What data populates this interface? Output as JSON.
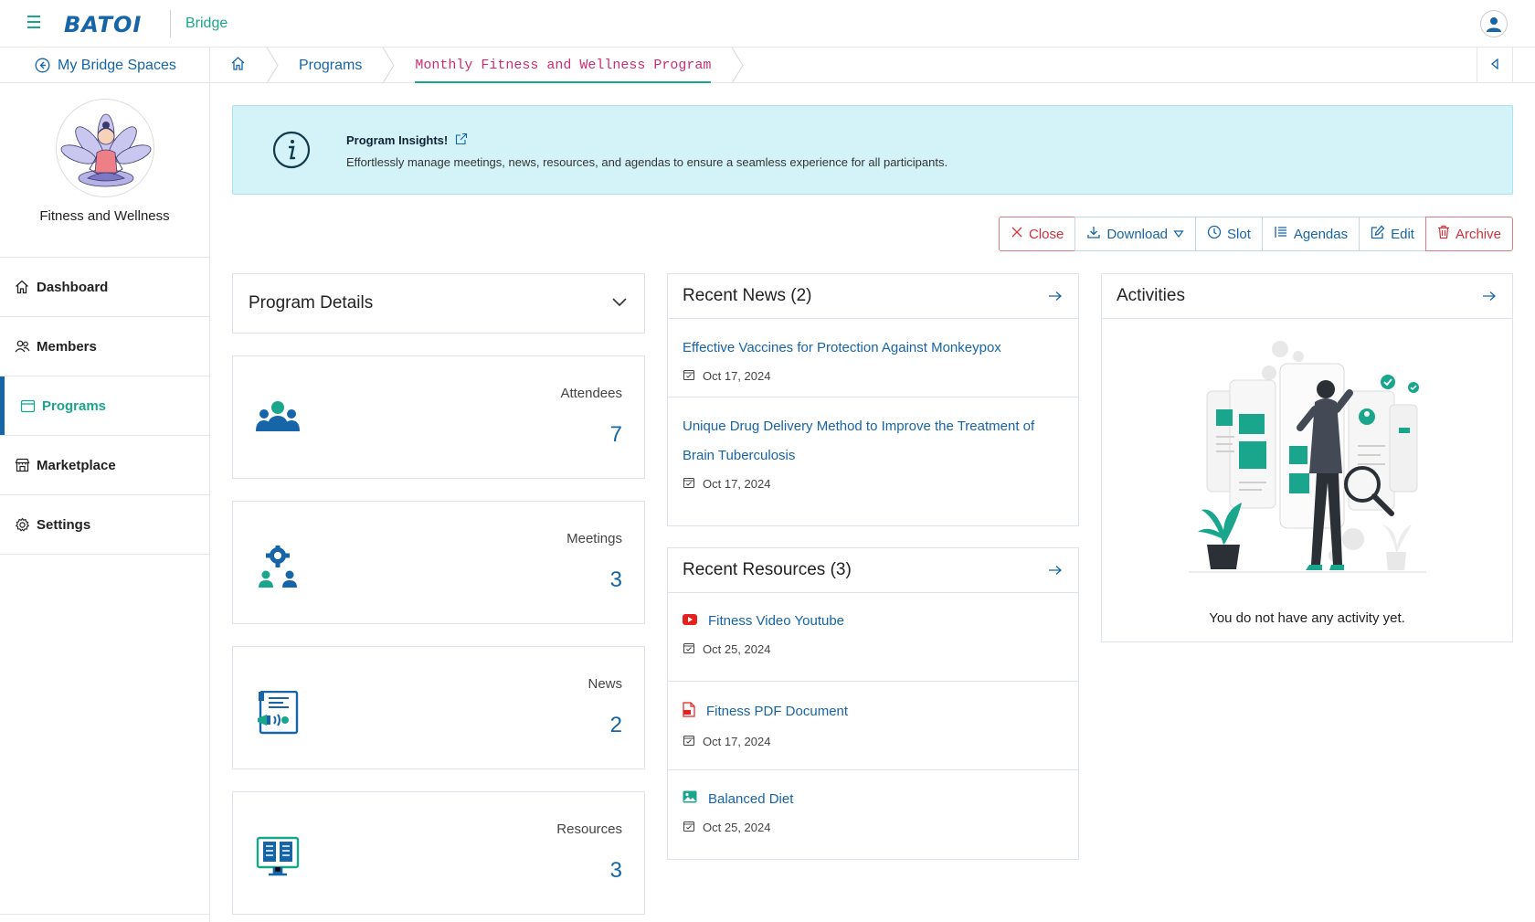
{
  "app": {
    "logo_text": "BATOI",
    "name": "Bridge",
    "brand_color": "#1565a8",
    "accent_color": "#1aa68c",
    "active_crumb_color": "#d02c72"
  },
  "subnav": {
    "back_label": "My Bridge Spaces",
    "breadcrumbs": [
      "Programs",
      "Monthly Fitness and Wellness Program"
    ]
  },
  "sidebar": {
    "space_name": "Fitness and Wellness",
    "items": [
      {
        "label": "Dashboard",
        "icon": "home-icon"
      },
      {
        "label": "Members",
        "icon": "members-icon"
      },
      {
        "label": "Programs",
        "icon": "calendar-icon",
        "active": true
      },
      {
        "label": "Marketplace",
        "icon": "store-icon"
      },
      {
        "label": "Settings",
        "icon": "gear-icon"
      }
    ]
  },
  "insight": {
    "title": "Program Insights!",
    "text": "Effortlessly manage meetings, news, resources, and agendas to ensure a seamless experience for all participants."
  },
  "actions": {
    "close": "Close",
    "download": "Download",
    "slot": "Slot",
    "agendas": "Agendas",
    "edit": "Edit",
    "archive": "Archive"
  },
  "program_details": {
    "title": "Program Details"
  },
  "stats": [
    {
      "label": "Attendees",
      "value": "7",
      "icon": "attendees-icon"
    },
    {
      "label": "Meetings",
      "value": "3",
      "icon": "meetings-icon"
    },
    {
      "label": "News",
      "value": "2",
      "icon": "news-icon"
    },
    {
      "label": "Resources",
      "value": "3",
      "icon": "resources-icon"
    }
  ],
  "news": {
    "title": "Recent News (2)",
    "items": [
      {
        "title": "Effective Vaccines for Protection Against Monkeypox",
        "date": "Oct 17, 2024"
      },
      {
        "title": "Unique Drug Delivery Method to Improve the Treatment of Brain Tuberculosis",
        "date": "Oct 17, 2024"
      }
    ]
  },
  "resources": {
    "title": "Recent Resources (3)",
    "items": [
      {
        "title": "Fitness Video Youtube",
        "date": "Oct 25, 2024",
        "icon": "youtube-icon"
      },
      {
        "title": "Fitness PDF Document",
        "date": "Oct 17, 2024",
        "icon": "pdf-icon"
      },
      {
        "title": "Balanced Diet",
        "date": "Oct 25, 2024",
        "icon": "image-icon"
      }
    ]
  },
  "activities": {
    "title": "Activities",
    "empty_text": "You do not have any activity yet."
  }
}
